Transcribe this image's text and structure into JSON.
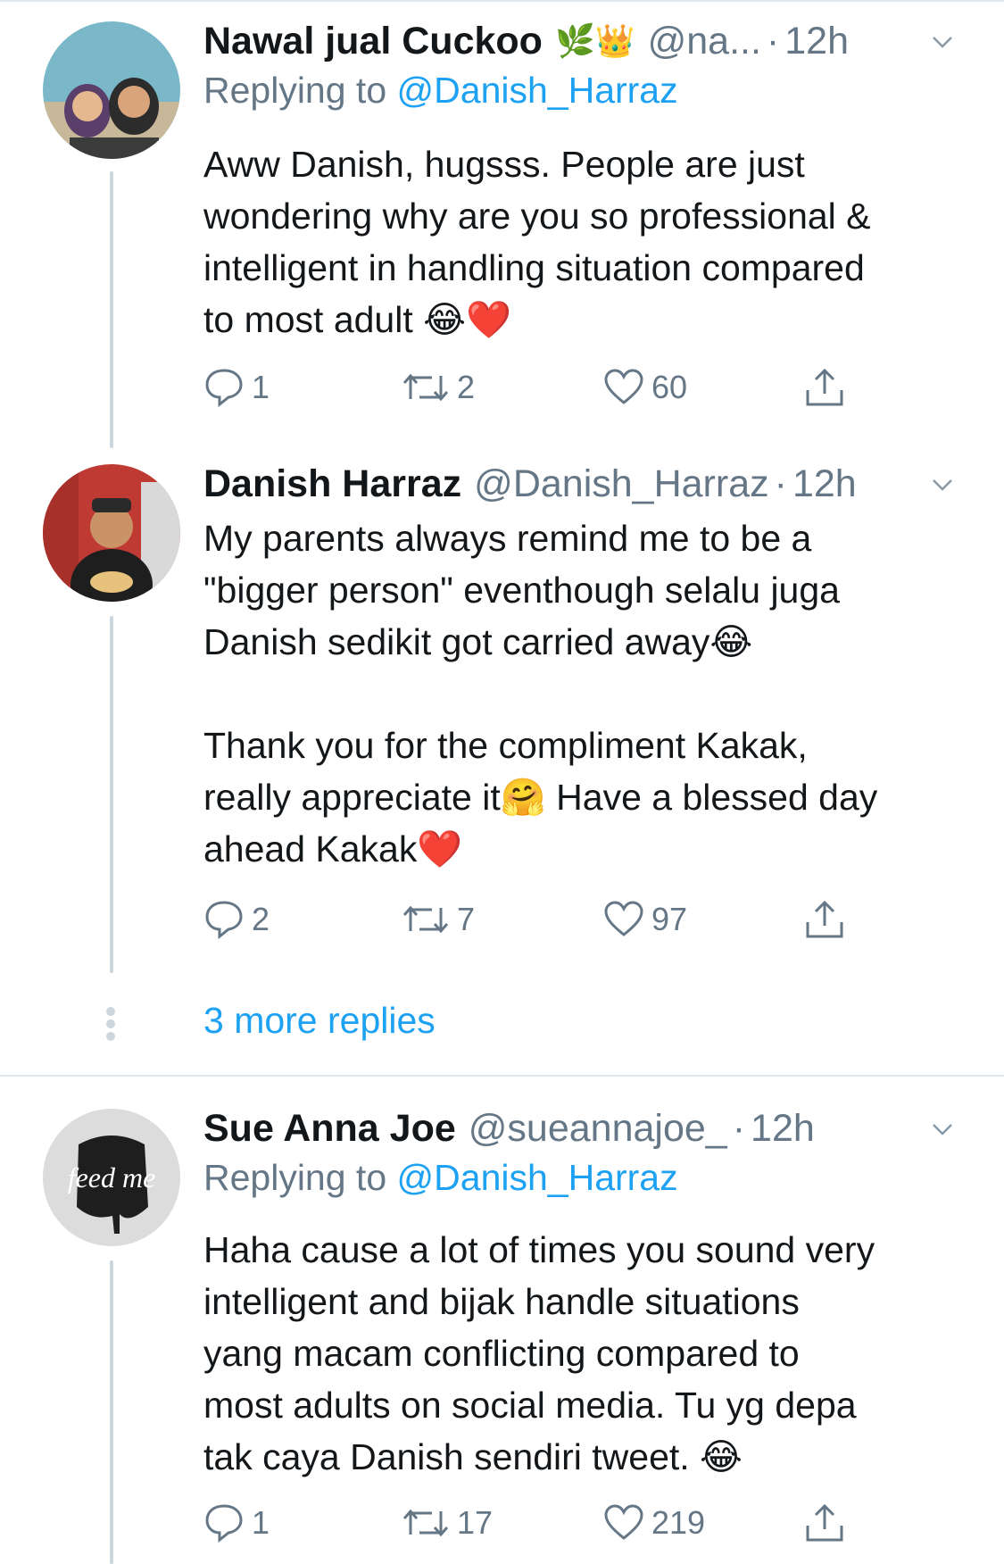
{
  "tweets": [
    {
      "name": "Nawal jual Cuckoo",
      "badges": "🌿👑",
      "handle": "@na...",
      "time": "12h",
      "replying_label": "Replying to",
      "replying_to": "@Danish_Harraz",
      "text": "Aww Danish, hugsss. People are just\nwondering why are you so professional &\nintelligent in handling situation compared\nto most adult 😂❤️",
      "replies": "1",
      "retweets": "2",
      "likes": "60"
    },
    {
      "name": "Danish Harraz",
      "handle": "@Danish_Harraz",
      "time": "12h",
      "text": "My parents always remind me to be a\n\"bigger person\" eventhough selalu juga\nDanish sedikit got carried away😂\n\nThank you for the compliment Kakak,\nreally appreciate it🤗 Have a blessed day\nahead Kakak❤️",
      "replies": "2",
      "retweets": "7",
      "likes": "97"
    },
    {
      "name": "Sue Anna Joe",
      "handle": "@sueannajoe_",
      "time": "12h",
      "replying_label": "Replying to",
      "replying_to": "@Danish_Harraz",
      "text": "Haha cause a lot of times you sound very\nintelligent and bijak handle situations\nyang macam conflicting compared to\nmost adults on social media. Tu yg depa\ntak caya Danish sendiri tweet. 😂",
      "replies": "1",
      "retweets": "17",
      "likes": "219"
    }
  ],
  "thread": {
    "more_replies": "3 more replies"
  },
  "avatar_text": {
    "feed_me": "feed me"
  },
  "colors": {
    "link": "#1da1f2",
    "secondary": "#657786",
    "divider": "#e1e8ed",
    "thread_line": "#ccd6dd"
  }
}
